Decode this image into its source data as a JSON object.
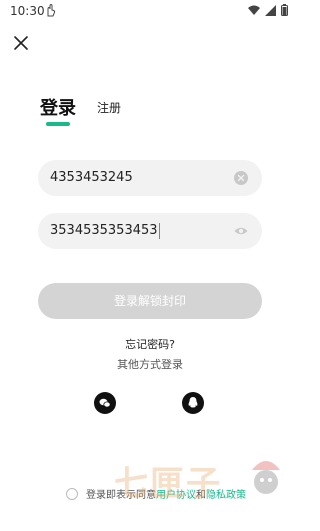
{
  "status_bar": {
    "time": "10:30"
  },
  "tabs": {
    "login": "登录",
    "register": "注册"
  },
  "form": {
    "phone_value": "4353453245",
    "password_value": "3534535353453",
    "submit_label": "登录解锁封印"
  },
  "links": {
    "forgot": "忘记密码?",
    "other_login": "其他方式登录"
  },
  "agreement": {
    "prefix": "登录即表示同意",
    "user_agreement": "用户协议",
    "and": "和",
    "privacy": "隐私政策"
  },
  "watermark": {
    "text": "七匣子"
  },
  "colors": {
    "accent": "#18b98b",
    "submit_disabled": "#d4d4d4",
    "field_bg": "#f2f2f2"
  },
  "icons": {
    "close": "close-icon",
    "clear": "clear-icon",
    "eye": "eye-icon",
    "wechat": "wechat-icon",
    "qq": "qq-icon",
    "wifi": "wifi-icon",
    "signal": "signal-icon",
    "battery": "battery-icon"
  }
}
